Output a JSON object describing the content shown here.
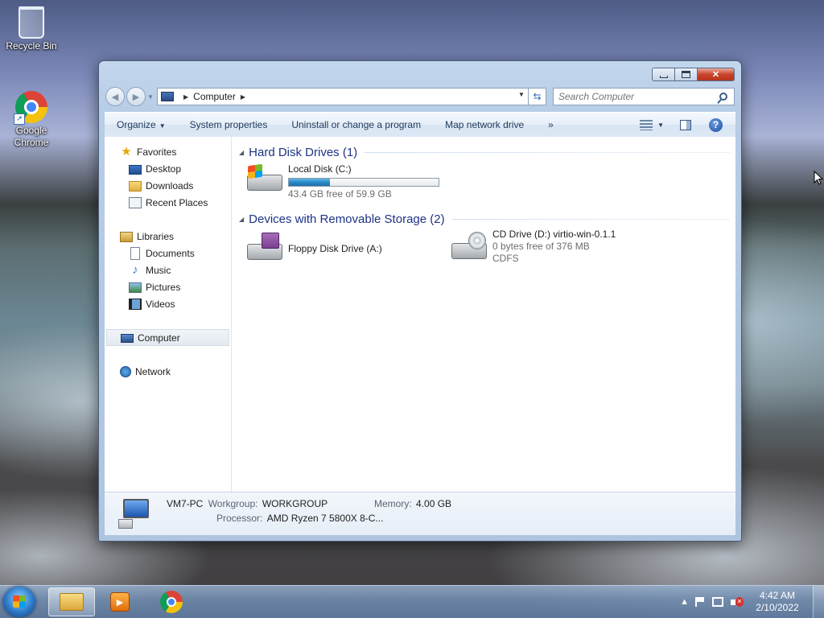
{
  "desktop": {
    "icons": [
      {
        "label": "Recycle Bin",
        "icon": "recycle-bin-icon"
      },
      {
        "label": "Google Chrome",
        "label_line1": "Google",
        "label_line2": "Chrome",
        "icon": "chrome-icon"
      }
    ]
  },
  "window": {
    "address": {
      "root_icon": "computer-icon",
      "path": [
        "Computer"
      ]
    },
    "search": {
      "placeholder": "Search Computer"
    },
    "toolbar": {
      "organize": "Organize",
      "system_properties": "System properties",
      "uninstall": "Uninstall or change a program",
      "map_drive": "Map network drive",
      "more": "»"
    },
    "nav": {
      "favorites": "Favorites",
      "favorites_items": [
        "Desktop",
        "Downloads",
        "Recent Places"
      ],
      "libraries": "Libraries",
      "libraries_items": [
        "Documents",
        "Music",
        "Pictures",
        "Videos"
      ],
      "computer": "Computer",
      "network": "Network"
    },
    "groups": [
      {
        "title": "Hard Disk Drives (1)",
        "drives": [
          {
            "name": "Local Disk (C:)",
            "sub": "43.4 GB free of 59.9 GB",
            "used_percent": 27.5,
            "icon": "windows-hard-disk-icon"
          }
        ]
      },
      {
        "title": "Devices with Removable Storage (2)",
        "drives": [
          {
            "name": "Floppy Disk Drive (A:)",
            "icon": "floppy-drive-icon"
          },
          {
            "name": "CD Drive (D:) virtio-win-0.1.1",
            "sub": "0 bytes free of 376 MB",
            "sub2": "CDFS",
            "icon": "cd-drive-icon"
          }
        ]
      }
    ],
    "details": {
      "pc_name": "VM7-PC",
      "workgroup_label": "Workgroup:",
      "workgroup": "WORKGROUP",
      "memory_label": "Memory:",
      "memory": "4.00 GB",
      "processor_label": "Processor:",
      "processor": "AMD Ryzen 7 5800X 8-C..."
    }
  },
  "taskbar": {
    "pinned": [
      "windows-explorer-icon",
      "media-player-icon",
      "chrome-icon"
    ],
    "clock_time": "4:42 AM",
    "clock_date": "2/10/2022",
    "tray_arrow": "▲"
  },
  "colors": {
    "group_header": "#1e3287",
    "bar_fill": "#2689c6",
    "close_button": "#c7442c"
  }
}
